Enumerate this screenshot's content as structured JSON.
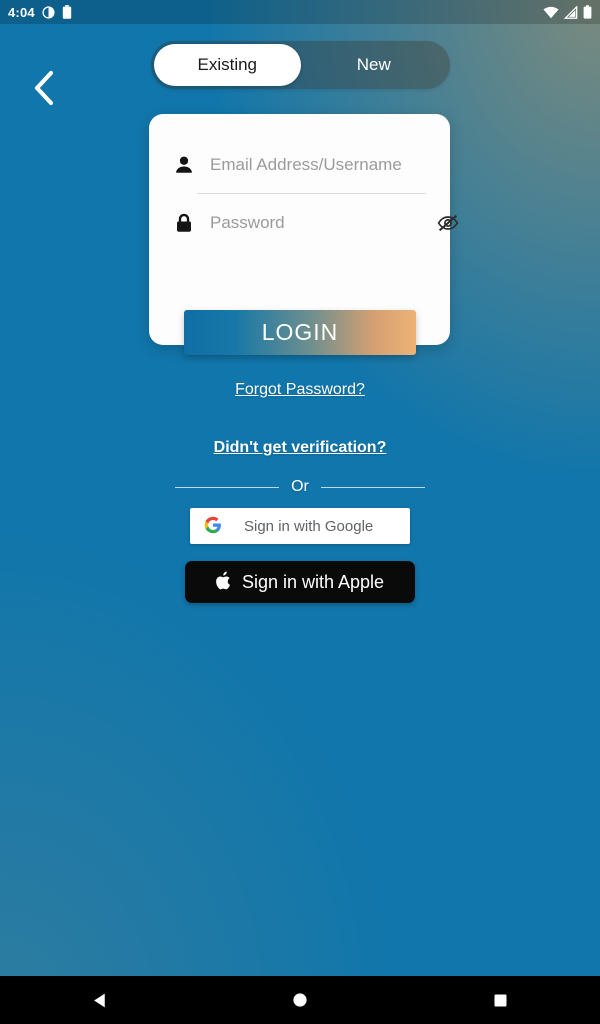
{
  "status_bar": {
    "time": "4:04",
    "left_icons": [
      "do-not-disturb-icon",
      "battery-saver-icon"
    ],
    "right_icons": [
      "wifi-icon",
      "cellular-signal-icon",
      "battery-icon"
    ]
  },
  "nav": {
    "back_icon": "chevron-left-icon"
  },
  "tabs": [
    {
      "label": "Existing",
      "active": true
    },
    {
      "label": "New",
      "active": false
    }
  ],
  "form": {
    "username": {
      "icon": "person-icon",
      "placeholder": "Email Address/Username",
      "value": ""
    },
    "password": {
      "icon": "lock-icon",
      "placeholder": "Password",
      "value": "",
      "toggle_icon": "eye-off-icon"
    }
  },
  "login_button": {
    "label": "LOGIN",
    "gradient_start": "#0f6ea5",
    "gradient_end": "#edb277"
  },
  "links": {
    "forgot_password": "Forgot Password?",
    "didnt_get_verification": "Didn't get verification?"
  },
  "divider": {
    "label": "Or"
  },
  "social": {
    "google": {
      "label": "Sign in with Google",
      "icon": "google-g-icon"
    },
    "apple": {
      "label": "Sign in with Apple",
      "icon": "apple-logo-icon"
    }
  },
  "system_nav": {
    "back": "back-triangle-icon",
    "home": "home-circle-icon",
    "recents": "recents-square-icon"
  },
  "colors": {
    "background_top_left": "#efa263",
    "background_top_right": "#b39a72",
    "background_bottom_left": "#4d8499",
    "background_bottom_right": "#0f74ab",
    "card": "#fdfdfd",
    "apple_button": "#0a0a0a",
    "google_text": "#5f6368"
  }
}
